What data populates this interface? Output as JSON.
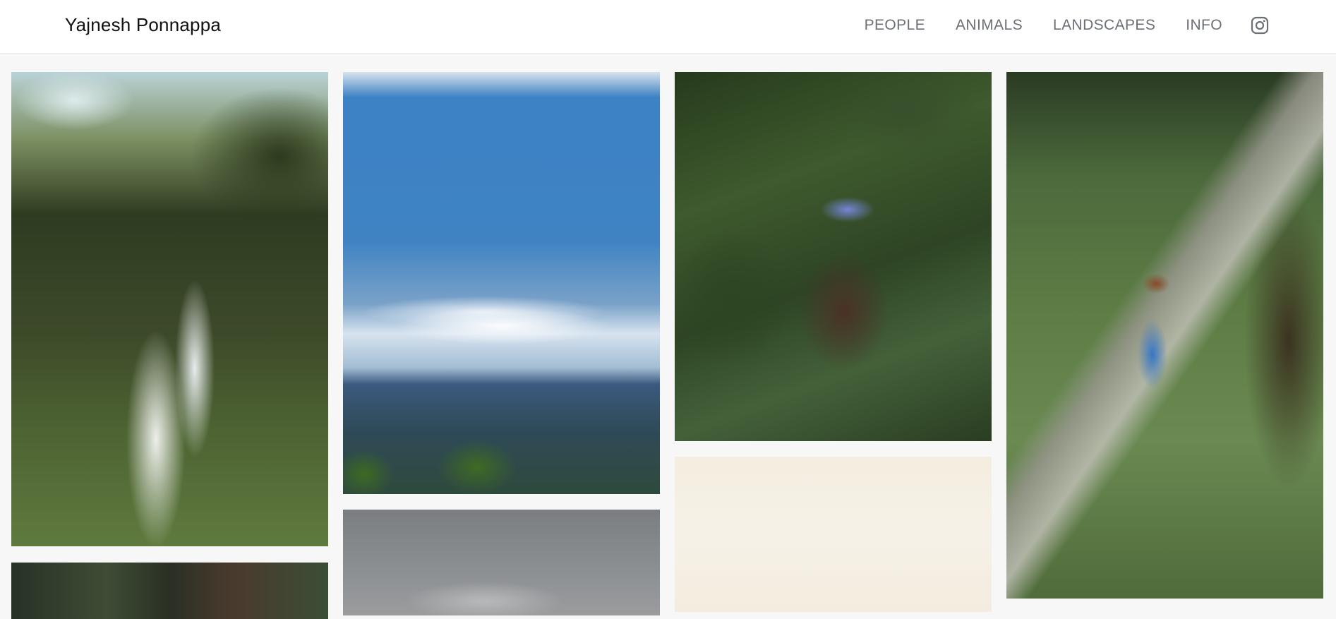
{
  "header": {
    "site_title": "Yajnesh Ponnappa",
    "nav": [
      "PEOPLE",
      "ANIMALS",
      "LANDSCAPES",
      "INFO"
    ],
    "social_icon": "instagram-icon"
  },
  "gallery": {
    "photos": [
      {
        "subject": "waterfall-in-forest"
      },
      {
        "subject": "blue-sky-over-hills"
      },
      {
        "subject": "blue-bird-on-branch"
      },
      {
        "subject": "kingfisher-on-branch"
      },
      {
        "subject": "person-partial"
      },
      {
        "subject": "cloudy-sky-partial"
      },
      {
        "subject": "cream-background-partial"
      }
    ]
  },
  "colors": {
    "header_bg": "#ffffff",
    "page_bg": "#f7f7f7",
    "nav_text": "#6b6f76",
    "title_text": "#111111"
  }
}
